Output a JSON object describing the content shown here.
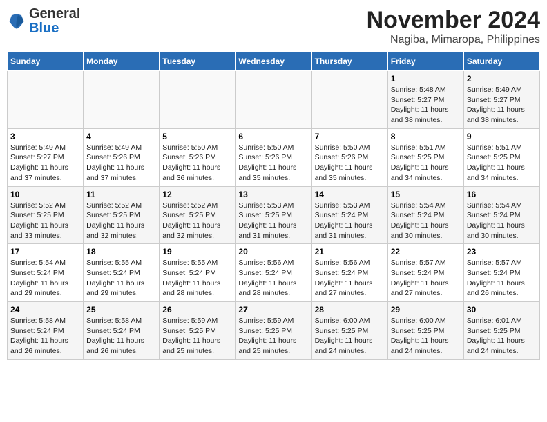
{
  "header": {
    "logo_general": "General",
    "logo_blue": "Blue",
    "title": "November 2024",
    "subtitle": "Nagiba, Mimaropa, Philippines"
  },
  "days_of_week": [
    "Sunday",
    "Monday",
    "Tuesday",
    "Wednesday",
    "Thursday",
    "Friday",
    "Saturday"
  ],
  "weeks": [
    [
      {
        "day": "",
        "info": ""
      },
      {
        "day": "",
        "info": ""
      },
      {
        "day": "",
        "info": ""
      },
      {
        "day": "",
        "info": ""
      },
      {
        "day": "",
        "info": ""
      },
      {
        "day": "1",
        "info": "Sunrise: 5:48 AM\nSunset: 5:27 PM\nDaylight: 11 hours and 38 minutes."
      },
      {
        "day": "2",
        "info": "Sunrise: 5:49 AM\nSunset: 5:27 PM\nDaylight: 11 hours and 38 minutes."
      }
    ],
    [
      {
        "day": "3",
        "info": "Sunrise: 5:49 AM\nSunset: 5:27 PM\nDaylight: 11 hours and 37 minutes."
      },
      {
        "day": "4",
        "info": "Sunrise: 5:49 AM\nSunset: 5:26 PM\nDaylight: 11 hours and 37 minutes."
      },
      {
        "day": "5",
        "info": "Sunrise: 5:50 AM\nSunset: 5:26 PM\nDaylight: 11 hours and 36 minutes."
      },
      {
        "day": "6",
        "info": "Sunrise: 5:50 AM\nSunset: 5:26 PM\nDaylight: 11 hours and 35 minutes."
      },
      {
        "day": "7",
        "info": "Sunrise: 5:50 AM\nSunset: 5:26 PM\nDaylight: 11 hours and 35 minutes."
      },
      {
        "day": "8",
        "info": "Sunrise: 5:51 AM\nSunset: 5:25 PM\nDaylight: 11 hours and 34 minutes."
      },
      {
        "day": "9",
        "info": "Sunrise: 5:51 AM\nSunset: 5:25 PM\nDaylight: 11 hours and 34 minutes."
      }
    ],
    [
      {
        "day": "10",
        "info": "Sunrise: 5:52 AM\nSunset: 5:25 PM\nDaylight: 11 hours and 33 minutes."
      },
      {
        "day": "11",
        "info": "Sunrise: 5:52 AM\nSunset: 5:25 PM\nDaylight: 11 hours and 32 minutes."
      },
      {
        "day": "12",
        "info": "Sunrise: 5:52 AM\nSunset: 5:25 PM\nDaylight: 11 hours and 32 minutes."
      },
      {
        "day": "13",
        "info": "Sunrise: 5:53 AM\nSunset: 5:25 PM\nDaylight: 11 hours and 31 minutes."
      },
      {
        "day": "14",
        "info": "Sunrise: 5:53 AM\nSunset: 5:24 PM\nDaylight: 11 hours and 31 minutes."
      },
      {
        "day": "15",
        "info": "Sunrise: 5:54 AM\nSunset: 5:24 PM\nDaylight: 11 hours and 30 minutes."
      },
      {
        "day": "16",
        "info": "Sunrise: 5:54 AM\nSunset: 5:24 PM\nDaylight: 11 hours and 30 minutes."
      }
    ],
    [
      {
        "day": "17",
        "info": "Sunrise: 5:54 AM\nSunset: 5:24 PM\nDaylight: 11 hours and 29 minutes."
      },
      {
        "day": "18",
        "info": "Sunrise: 5:55 AM\nSunset: 5:24 PM\nDaylight: 11 hours and 29 minutes."
      },
      {
        "day": "19",
        "info": "Sunrise: 5:55 AM\nSunset: 5:24 PM\nDaylight: 11 hours and 28 minutes."
      },
      {
        "day": "20",
        "info": "Sunrise: 5:56 AM\nSunset: 5:24 PM\nDaylight: 11 hours and 28 minutes."
      },
      {
        "day": "21",
        "info": "Sunrise: 5:56 AM\nSunset: 5:24 PM\nDaylight: 11 hours and 27 minutes."
      },
      {
        "day": "22",
        "info": "Sunrise: 5:57 AM\nSunset: 5:24 PM\nDaylight: 11 hours and 27 minutes."
      },
      {
        "day": "23",
        "info": "Sunrise: 5:57 AM\nSunset: 5:24 PM\nDaylight: 11 hours and 26 minutes."
      }
    ],
    [
      {
        "day": "24",
        "info": "Sunrise: 5:58 AM\nSunset: 5:24 PM\nDaylight: 11 hours and 26 minutes."
      },
      {
        "day": "25",
        "info": "Sunrise: 5:58 AM\nSunset: 5:24 PM\nDaylight: 11 hours and 26 minutes."
      },
      {
        "day": "26",
        "info": "Sunrise: 5:59 AM\nSunset: 5:25 PM\nDaylight: 11 hours and 25 minutes."
      },
      {
        "day": "27",
        "info": "Sunrise: 5:59 AM\nSunset: 5:25 PM\nDaylight: 11 hours and 25 minutes."
      },
      {
        "day": "28",
        "info": "Sunrise: 6:00 AM\nSunset: 5:25 PM\nDaylight: 11 hours and 24 minutes."
      },
      {
        "day": "29",
        "info": "Sunrise: 6:00 AM\nSunset: 5:25 PM\nDaylight: 11 hours and 24 minutes."
      },
      {
        "day": "30",
        "info": "Sunrise: 6:01 AM\nSunset: 5:25 PM\nDaylight: 11 hours and 24 minutes."
      }
    ]
  ]
}
